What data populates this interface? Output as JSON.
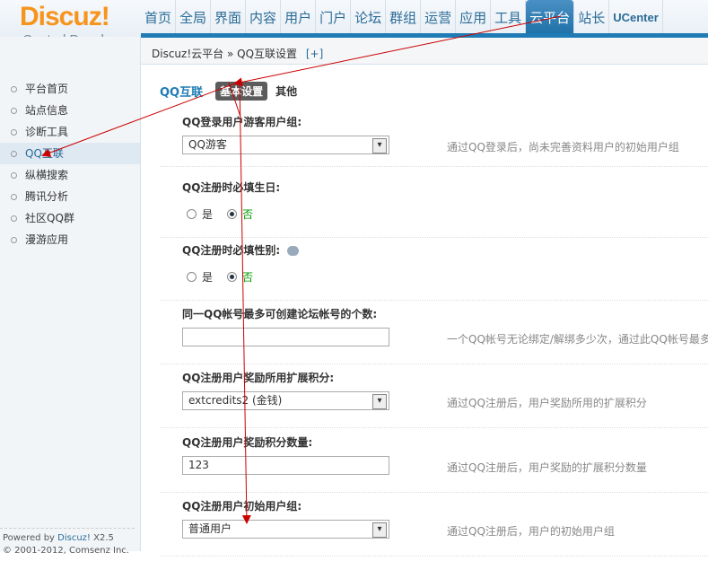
{
  "header": {
    "logo": "Discuz!",
    "logo_sub": "Control Panel",
    "nav": [
      "首页",
      "全局",
      "界面",
      "内容",
      "用户",
      "门户",
      "论坛",
      "群组",
      "运营",
      "应用",
      "工具",
      "云平台",
      "站长",
      "UCenter"
    ],
    "active_nav": "云平台"
  },
  "breadcrumb": {
    "root": "Discuz!云平台",
    "sep": "»",
    "current": "QQ互联设置",
    "plus": "[+]"
  },
  "sidebar": {
    "items": [
      "平台首页",
      "站点信息",
      "诊断工具",
      "QQ互联",
      "纵横搜索",
      "腾讯分析",
      "社区QQ群",
      "漫游应用"
    ],
    "active": "QQ互联"
  },
  "footer": {
    "powered": "Powered by",
    "brand": "Discuz!",
    "version": "X2.5",
    "copyright": "© 2001-2012, Comsenz Inc."
  },
  "main": {
    "title": "QQ互联",
    "tabs": [
      "基本设置",
      "其他"
    ],
    "settings": [
      {
        "label": "QQ登录用户游客用户组:",
        "value": "QQ游客",
        "tip": "通过QQ登录后，尚未完善资料用户的初始用户组"
      },
      {
        "label": "QQ注册时必填生日:",
        "yes": "是",
        "no": "否"
      },
      {
        "label": "QQ注册时必填性别:",
        "yes": "是",
        "no": "否"
      },
      {
        "label": "同一QQ帐号最多可创建论坛帐号的个数:",
        "value": "",
        "tip": "一个QQ帐号无论绑定/解绑多少次，通过此QQ帐号最多"
      },
      {
        "label": "QQ注册用户奖励所用扩展积分:",
        "value": "extcredits2 (金钱)",
        "tip": "通过QQ注册后，用户奖励所用的扩展积分"
      },
      {
        "label": "QQ注册用户奖励积分数量:",
        "value": "123",
        "tip": "通过QQ注册后，用户奖励的扩展积分数量"
      },
      {
        "label": "QQ注册用户初始用户组:",
        "value": "普通用户",
        "tip": "通过QQ注册后，用户的初始用户组"
      }
    ]
  },
  "colors": {
    "accent": "#1f7bb5",
    "annotation": "#cc0000"
  }
}
